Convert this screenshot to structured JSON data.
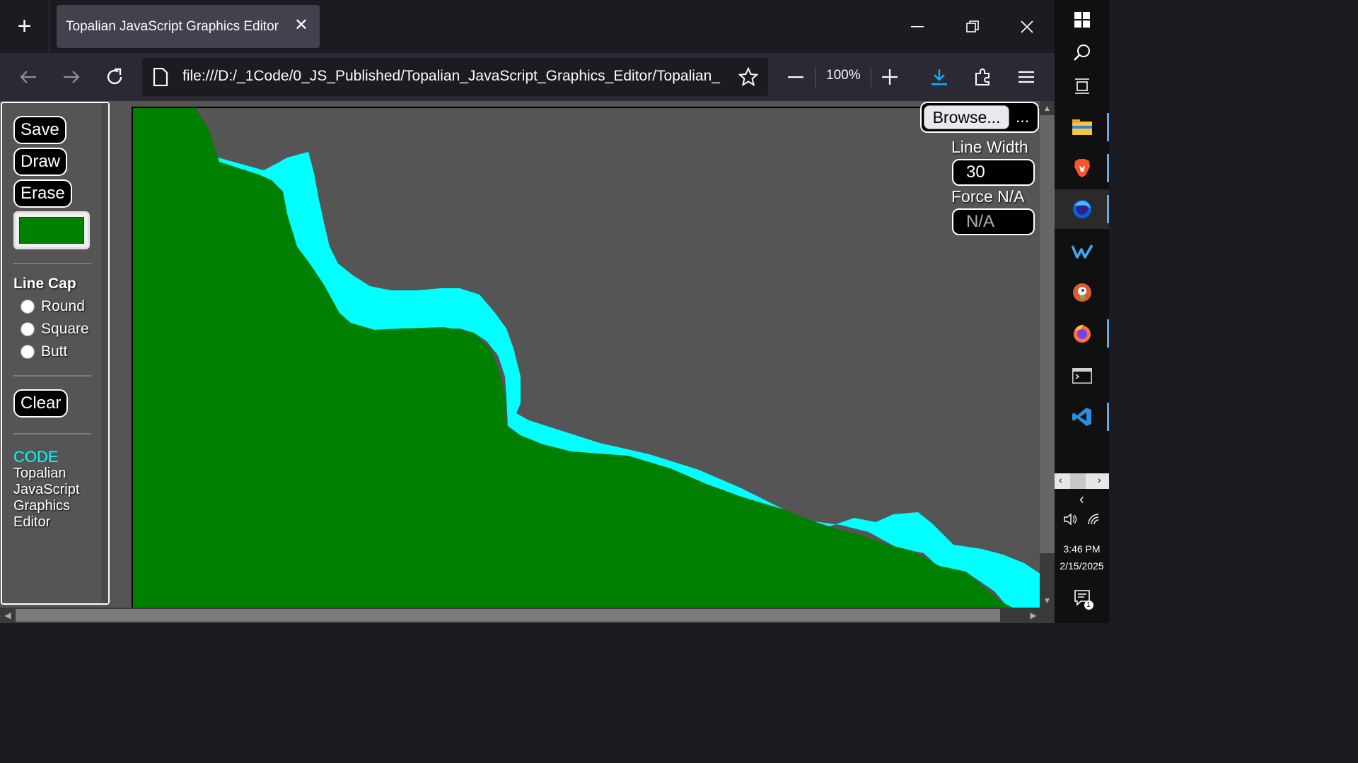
{
  "browser": {
    "tab_title": "Topalian JavaScript Graphics Editor",
    "url": "file:///D:/_1Code/0_JS_Published/Topalian_JavaScript_Graphics_Editor/Topalian_",
    "zoom": "100%"
  },
  "toolbar": {
    "save_label": "Save",
    "draw_label": "Draw",
    "erase_label": "Erase",
    "current_color": "#008000",
    "clear_label": "Clear"
  },
  "line_cap": {
    "heading": "Line Cap",
    "options": [
      "Round",
      "Square",
      "Butt"
    ]
  },
  "credits": {
    "link": "CODE",
    "lines": [
      "Topalian",
      "JavaScript",
      "Graphics",
      "Editor"
    ]
  },
  "file_input": {
    "browse_label": "Browse...",
    "status": "..."
  },
  "line_width": {
    "label": "Line Width",
    "value": "30"
  },
  "force": {
    "label": "Force N/A",
    "value": "N/A"
  },
  "canvas": {
    "background": "#555555",
    "fill_color": "#008000",
    "stroke_color": "#00ffff"
  },
  "taskbar": {
    "time": "3:46 PM",
    "date": "2/15/2025",
    "notification_count": "1"
  }
}
